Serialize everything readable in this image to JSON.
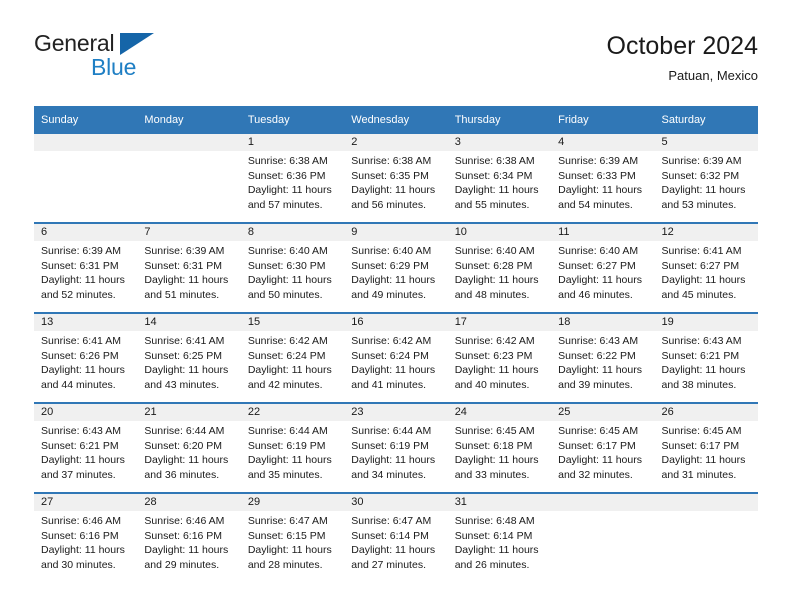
{
  "brand": {
    "name_part1": "General",
    "name_part2": "Blue",
    "triangle_color": "#1565a8",
    "blue_text_color": "#1f7fc4"
  },
  "header": {
    "title": "October 2024",
    "location": "Patuan, Mexico"
  },
  "theme": {
    "header_blue": "#3077b6",
    "day_band_gray": "#f0f0f0",
    "text_color": "#1a1a1a"
  },
  "weekday_headers": [
    "Sunday",
    "Monday",
    "Tuesday",
    "Wednesday",
    "Thursday",
    "Friday",
    "Saturday"
  ],
  "weeks": [
    [
      {
        "day": "",
        "sunrise": "",
        "sunset": "",
        "daylight_line1": "",
        "daylight_line2": ""
      },
      {
        "day": "",
        "sunrise": "",
        "sunset": "",
        "daylight_line1": "",
        "daylight_line2": ""
      },
      {
        "day": "1",
        "sunrise": "Sunrise: 6:38 AM",
        "sunset": "Sunset: 6:36 PM",
        "daylight_line1": "Daylight: 11 hours",
        "daylight_line2": "and 57 minutes."
      },
      {
        "day": "2",
        "sunrise": "Sunrise: 6:38 AM",
        "sunset": "Sunset: 6:35 PM",
        "daylight_line1": "Daylight: 11 hours",
        "daylight_line2": "and 56 minutes."
      },
      {
        "day": "3",
        "sunrise": "Sunrise: 6:38 AM",
        "sunset": "Sunset: 6:34 PM",
        "daylight_line1": "Daylight: 11 hours",
        "daylight_line2": "and 55 minutes."
      },
      {
        "day": "4",
        "sunrise": "Sunrise: 6:39 AM",
        "sunset": "Sunset: 6:33 PM",
        "daylight_line1": "Daylight: 11 hours",
        "daylight_line2": "and 54 minutes."
      },
      {
        "day": "5",
        "sunrise": "Sunrise: 6:39 AM",
        "sunset": "Sunset: 6:32 PM",
        "daylight_line1": "Daylight: 11 hours",
        "daylight_line2": "and 53 minutes."
      }
    ],
    [
      {
        "day": "6",
        "sunrise": "Sunrise: 6:39 AM",
        "sunset": "Sunset: 6:31 PM",
        "daylight_line1": "Daylight: 11 hours",
        "daylight_line2": "and 52 minutes."
      },
      {
        "day": "7",
        "sunrise": "Sunrise: 6:39 AM",
        "sunset": "Sunset: 6:31 PM",
        "daylight_line1": "Daylight: 11 hours",
        "daylight_line2": "and 51 minutes."
      },
      {
        "day": "8",
        "sunrise": "Sunrise: 6:40 AM",
        "sunset": "Sunset: 6:30 PM",
        "daylight_line1": "Daylight: 11 hours",
        "daylight_line2": "and 50 minutes."
      },
      {
        "day": "9",
        "sunrise": "Sunrise: 6:40 AM",
        "sunset": "Sunset: 6:29 PM",
        "daylight_line1": "Daylight: 11 hours",
        "daylight_line2": "and 49 minutes."
      },
      {
        "day": "10",
        "sunrise": "Sunrise: 6:40 AM",
        "sunset": "Sunset: 6:28 PM",
        "daylight_line1": "Daylight: 11 hours",
        "daylight_line2": "and 48 minutes."
      },
      {
        "day": "11",
        "sunrise": "Sunrise: 6:40 AM",
        "sunset": "Sunset: 6:27 PM",
        "daylight_line1": "Daylight: 11 hours",
        "daylight_line2": "and 46 minutes."
      },
      {
        "day": "12",
        "sunrise": "Sunrise: 6:41 AM",
        "sunset": "Sunset: 6:27 PM",
        "daylight_line1": "Daylight: 11 hours",
        "daylight_line2": "and 45 minutes."
      }
    ],
    [
      {
        "day": "13",
        "sunrise": "Sunrise: 6:41 AM",
        "sunset": "Sunset: 6:26 PM",
        "daylight_line1": "Daylight: 11 hours",
        "daylight_line2": "and 44 minutes."
      },
      {
        "day": "14",
        "sunrise": "Sunrise: 6:41 AM",
        "sunset": "Sunset: 6:25 PM",
        "daylight_line1": "Daylight: 11 hours",
        "daylight_line2": "and 43 minutes."
      },
      {
        "day": "15",
        "sunrise": "Sunrise: 6:42 AM",
        "sunset": "Sunset: 6:24 PM",
        "daylight_line1": "Daylight: 11 hours",
        "daylight_line2": "and 42 minutes."
      },
      {
        "day": "16",
        "sunrise": "Sunrise: 6:42 AM",
        "sunset": "Sunset: 6:24 PM",
        "daylight_line1": "Daylight: 11 hours",
        "daylight_line2": "and 41 minutes."
      },
      {
        "day": "17",
        "sunrise": "Sunrise: 6:42 AM",
        "sunset": "Sunset: 6:23 PM",
        "daylight_line1": "Daylight: 11 hours",
        "daylight_line2": "and 40 minutes."
      },
      {
        "day": "18",
        "sunrise": "Sunrise: 6:43 AM",
        "sunset": "Sunset: 6:22 PM",
        "daylight_line1": "Daylight: 11 hours",
        "daylight_line2": "and 39 minutes."
      },
      {
        "day": "19",
        "sunrise": "Sunrise: 6:43 AM",
        "sunset": "Sunset: 6:21 PM",
        "daylight_line1": "Daylight: 11 hours",
        "daylight_line2": "and 38 minutes."
      }
    ],
    [
      {
        "day": "20",
        "sunrise": "Sunrise: 6:43 AM",
        "sunset": "Sunset: 6:21 PM",
        "daylight_line1": "Daylight: 11 hours",
        "daylight_line2": "and 37 minutes."
      },
      {
        "day": "21",
        "sunrise": "Sunrise: 6:44 AM",
        "sunset": "Sunset: 6:20 PM",
        "daylight_line1": "Daylight: 11 hours",
        "daylight_line2": "and 36 minutes."
      },
      {
        "day": "22",
        "sunrise": "Sunrise: 6:44 AM",
        "sunset": "Sunset: 6:19 PM",
        "daylight_line1": "Daylight: 11 hours",
        "daylight_line2": "and 35 minutes."
      },
      {
        "day": "23",
        "sunrise": "Sunrise: 6:44 AM",
        "sunset": "Sunset: 6:19 PM",
        "daylight_line1": "Daylight: 11 hours",
        "daylight_line2": "and 34 minutes."
      },
      {
        "day": "24",
        "sunrise": "Sunrise: 6:45 AM",
        "sunset": "Sunset: 6:18 PM",
        "daylight_line1": "Daylight: 11 hours",
        "daylight_line2": "and 33 minutes."
      },
      {
        "day": "25",
        "sunrise": "Sunrise: 6:45 AM",
        "sunset": "Sunset: 6:17 PM",
        "daylight_line1": "Daylight: 11 hours",
        "daylight_line2": "and 32 minutes."
      },
      {
        "day": "26",
        "sunrise": "Sunrise: 6:45 AM",
        "sunset": "Sunset: 6:17 PM",
        "daylight_line1": "Daylight: 11 hours",
        "daylight_line2": "and 31 minutes."
      }
    ],
    [
      {
        "day": "27",
        "sunrise": "Sunrise: 6:46 AM",
        "sunset": "Sunset: 6:16 PM",
        "daylight_line1": "Daylight: 11 hours",
        "daylight_line2": "and 30 minutes."
      },
      {
        "day": "28",
        "sunrise": "Sunrise: 6:46 AM",
        "sunset": "Sunset: 6:16 PM",
        "daylight_line1": "Daylight: 11 hours",
        "daylight_line2": "and 29 minutes."
      },
      {
        "day": "29",
        "sunrise": "Sunrise: 6:47 AM",
        "sunset": "Sunset: 6:15 PM",
        "daylight_line1": "Daylight: 11 hours",
        "daylight_line2": "and 28 minutes."
      },
      {
        "day": "30",
        "sunrise": "Sunrise: 6:47 AM",
        "sunset": "Sunset: 6:14 PM",
        "daylight_line1": "Daylight: 11 hours",
        "daylight_line2": "and 27 minutes."
      },
      {
        "day": "31",
        "sunrise": "Sunrise: 6:48 AM",
        "sunset": "Sunset: 6:14 PM",
        "daylight_line1": "Daylight: 11 hours",
        "daylight_line2": "and 26 minutes."
      },
      {
        "day": "",
        "sunrise": "",
        "sunset": "",
        "daylight_line1": "",
        "daylight_line2": ""
      },
      {
        "day": "",
        "sunrise": "",
        "sunset": "",
        "daylight_line1": "",
        "daylight_line2": ""
      }
    ]
  ]
}
